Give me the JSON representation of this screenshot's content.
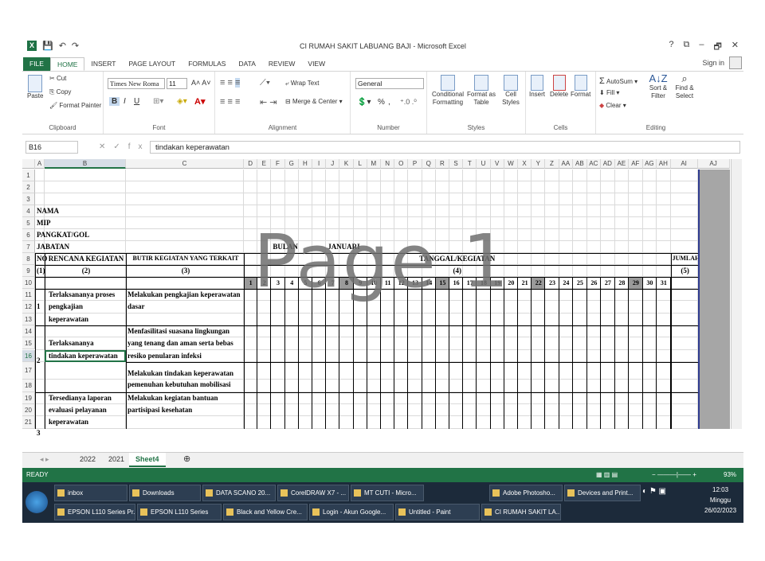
{
  "window": {
    "title": "CI RUMAH SAKIT LABUANG BAJI - Microsoft Excel",
    "signin": "Sign in",
    "controls": [
      "?",
      "⧉",
      "–",
      "🗗",
      "✕"
    ]
  },
  "tabs": [
    "FILE",
    "HOME",
    "INSERT",
    "PAGE LAYOUT",
    "FORMULAS",
    "DATA",
    "REVIEW",
    "VIEW"
  ],
  "ribbon": {
    "clipboard": {
      "paste": "Paste",
      "cut": "Cut",
      "copy": "Copy",
      "painter": "Format Painter",
      "label": "Clipboard"
    },
    "font": {
      "name": "Times New Roma",
      "size": "11",
      "label": "Font",
      "bold": "B",
      "italic": "I",
      "underline": "U"
    },
    "alignment": {
      "wrap": "Wrap Text",
      "merge": "Merge & Center",
      "label": "Alignment"
    },
    "number": {
      "format": "General",
      "label": "Number",
      "percent": "%",
      "comma": ","
    },
    "styles": {
      "cond": "Conditional Formatting",
      "table": "Format as Table",
      "cell": "Cell Styles",
      "label": "Styles"
    },
    "cells": {
      "insert": "Insert",
      "delete": "Delete",
      "format": "Format",
      "label": "Cells"
    },
    "editing": {
      "autosum": "AutoSum",
      "fill": "Fill",
      "clear": "Clear",
      "sort": "Sort & Filter",
      "find": "Find & Select",
      "label": "Editing"
    }
  },
  "formula": {
    "namebox": "B16",
    "fx": "fx",
    "content": "tindakan keperawatan"
  },
  "columns": [
    "A",
    "B",
    "C",
    "D",
    "E",
    "F",
    "G",
    "H",
    "I",
    "J",
    "K",
    "L",
    "M",
    "N",
    "O",
    "P",
    "Q",
    "R",
    "S",
    "T",
    "U",
    "V",
    "W",
    "X",
    "Y",
    "Z",
    "AA",
    "AB",
    "AC",
    "AD",
    "AE",
    "AF",
    "AG",
    "AH",
    "AI",
    "AJ"
  ],
  "rows": [
    "1",
    "2",
    "3",
    "4",
    "5",
    "6",
    "7",
    "8",
    "9",
    "10",
    "11",
    "12",
    "13",
    "14",
    "15",
    "16",
    "17",
    "18",
    "19",
    "20",
    "21"
  ],
  "cells": {
    "nama": "NAMA",
    "mip": "MIP",
    "pangkat": "PANGKAT/GOL",
    "jabatan": "JABATAN",
    "bulan": "BULAN",
    "januari": "JANUARI",
    "no": "NO",
    "rencana": "RENCANA KEGIATAN",
    "butir": "BUTIR KEGIATAN YANG TERKAIT",
    "tanggal": "TANGGAL/KEGIATAN",
    "jumlah": "JUMLAH",
    "h1": "(1)",
    "h2": "(2)",
    "h3": "(3)",
    "h4": "(4)",
    "h5": "(5)",
    "r11b": "Terlaksananya proses",
    "r12b": "pengkajian",
    "r13b": "keperawatan",
    "r11c": "Melakukan pengkajian keperawatan",
    "r12c": "dasar",
    "n1": "1",
    "r14c": "Menfasilitasi suasana lingkungan",
    "r15c": "yang tenang dan aman serta bebas",
    "r16c": "resiko penularan infeksi",
    "r15b": "Terlaksananya",
    "r16b": "tindakan keperawatan",
    "n2": "2",
    "r17c": "Melakukan tindakan keperawatan",
    "r18c": "pemenuhan kebutuhan mobilisasi",
    "r19b": "Tersedianya laporan",
    "r20b": "evaluasi pelayanan",
    "r21b": "keperawatan",
    "r19c": "Melakukan kegiatan bantuan",
    "r20c": "partisipasi kesehatan",
    "n3": "3"
  },
  "days": [
    "1",
    "2",
    "3",
    "4",
    "5",
    "6",
    "7",
    "8",
    "9",
    "10",
    "11",
    "12",
    "13",
    "14",
    "15",
    "16",
    "17",
    "18",
    "19",
    "20",
    "21",
    "22",
    "23",
    "24",
    "25",
    "26",
    "27",
    "28",
    "29",
    "30",
    "31"
  ],
  "shaded_days": [
    "1",
    "8",
    "15",
    "22",
    "29"
  ],
  "watermark": "Page 1",
  "sheets": [
    "2022",
    "2021",
    "Sheet4"
  ],
  "status": {
    "ready": "READY",
    "zoom": "93%"
  },
  "taskbar": {
    "row1": [
      "inbox",
      "Downloads",
      "DATA SCANO 20...",
      "CorelDRAW X7 - ...",
      "MT CUTI - Micro...",
      "Adobe Photosho...",
      "Devices and Print..."
    ],
    "row2": [
      "EPSON L110 Series Pr...",
      "EPSON L110 Series",
      "Black and Yellow Cre...",
      "Login - Akun Google...",
      "Untitled - Paint",
      "CI RUMAH SAKIT LA..."
    ],
    "time": "12:03",
    "day": "Minggu",
    "date": "26/02/2023"
  }
}
